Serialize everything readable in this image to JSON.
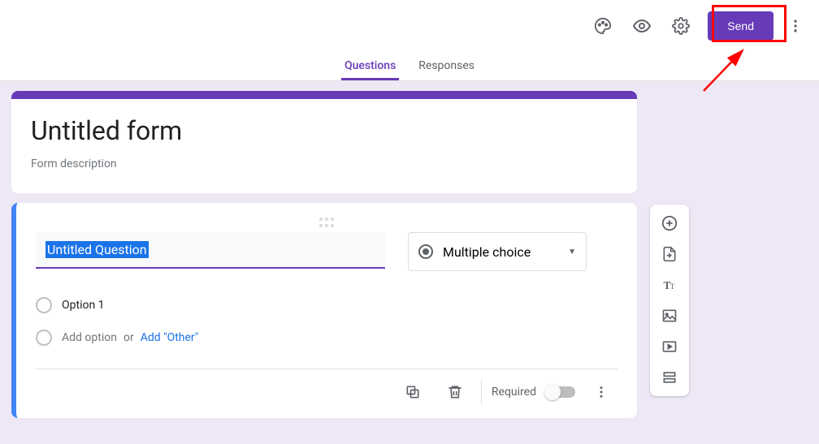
{
  "header": {
    "send_label": "Send"
  },
  "tabs": {
    "questions": "Questions",
    "responses": "Responses"
  },
  "form": {
    "title": "Untitled form",
    "description": "Form description"
  },
  "question": {
    "title": "Untitled Question",
    "type_label": "Multiple choice",
    "options": [
      "Option 1"
    ],
    "add_option": "Add option",
    "or": "or",
    "add_other": "Add \"Other\"",
    "required_label": "Required"
  },
  "icons": {
    "palette": "palette",
    "preview": "preview",
    "settings": "settings",
    "more": "more"
  }
}
